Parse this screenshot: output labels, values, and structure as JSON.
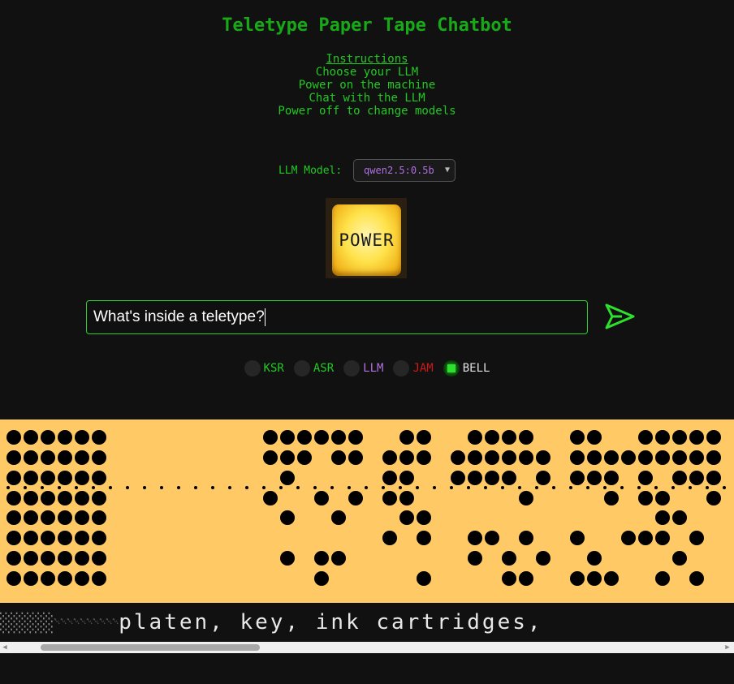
{
  "title": "Teletype Paper Tape Chatbot",
  "instructions": {
    "heading": "Instructions",
    "lines": [
      "Choose your LLM",
      "Power on the machine",
      "Chat with the LLM",
      "Power off to change models"
    ]
  },
  "model": {
    "label": "LLM Model:",
    "selected": "qwen2.5:0.5b"
  },
  "power": {
    "label": "POWER"
  },
  "chat": {
    "value": "What's inside a teletype?"
  },
  "indicators": [
    {
      "label": "KSR",
      "color": "#22c922",
      "on": false
    },
    {
      "label": "ASR",
      "color": "#22c922",
      "on": false
    },
    {
      "label": "LLM",
      "color": "#b070e0",
      "on": false
    },
    {
      "label": "JAM",
      "color": "#d01818",
      "on": false
    },
    {
      "label": "BELL",
      "color": "#e0e0e0",
      "on": true
    }
  ],
  "printout": {
    "text": "platen, key, ink cartridges,"
  },
  "colors": {
    "accent": "#22c922",
    "tape": "#ffc966",
    "background": "#111111"
  }
}
